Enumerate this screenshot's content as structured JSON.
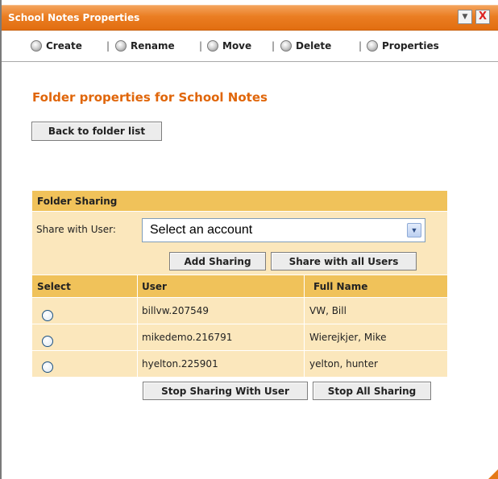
{
  "window": {
    "title": "School Notes Properties",
    "minimize_glyph": "▼",
    "close_glyph": "X"
  },
  "toolbar": {
    "items": [
      {
        "label": "Create",
        "icon": "radio-icon"
      },
      {
        "label": "Rename",
        "icon": "radio-icon"
      },
      {
        "label": "Move",
        "icon": "radio-icon"
      },
      {
        "label": "Delete",
        "icon": "radio-icon"
      },
      {
        "label": "Properties",
        "icon": "radio-icon"
      }
    ],
    "separator": "|"
  },
  "page": {
    "heading": "Folder properties for School Notes",
    "back_button": "Back to folder list"
  },
  "sharing": {
    "title": "Folder Sharing",
    "share_label": "Share with User:",
    "select_value": "Select an account",
    "add_button": "Add Sharing",
    "share_all_button": "Share with all Users",
    "columns": [
      "Select",
      "User",
      "Full Name"
    ],
    "rows": [
      {
        "user": "billvw.207549",
        "full_name": "VW, Bill"
      },
      {
        "user": "mikedemo.216791",
        "full_name": "Wierejkjer, Mike"
      },
      {
        "user": "hyelton.225901",
        "full_name": "yelton, hunter"
      }
    ],
    "stop_user_button": "Stop Sharing With User",
    "stop_all_button": "Stop All Sharing"
  },
  "colors": {
    "accent": "#e26e10",
    "heading": "#e0660a",
    "table_header": "#f0c25a",
    "table_row": "#fbe7bc"
  }
}
